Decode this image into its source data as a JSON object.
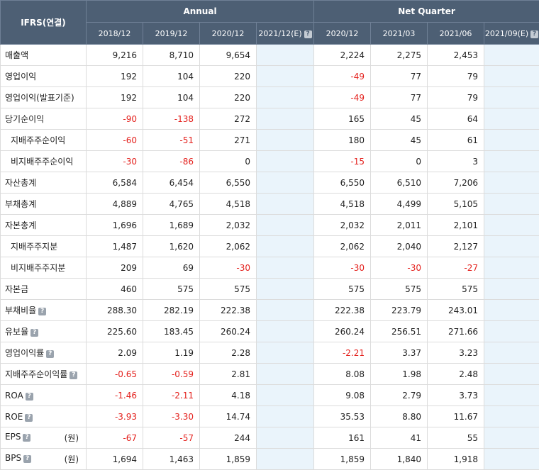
{
  "table": {
    "corner_label": "IFRS(연결)",
    "groups": [
      {
        "label": "Annual",
        "span": 4
      },
      {
        "label": "Net Quarter",
        "span": 4
      }
    ],
    "periods": [
      {
        "label": "2018/12",
        "estimate": false
      },
      {
        "label": "2019/12",
        "estimate": false
      },
      {
        "label": "2020/12",
        "estimate": false
      },
      {
        "label": "2021/12(E)",
        "estimate": true
      },
      {
        "label": "2020/12",
        "estimate": false
      },
      {
        "label": "2021/03",
        "estimate": false
      },
      {
        "label": "2021/06",
        "estimate": false
      },
      {
        "label": "2021/09(E)",
        "estimate": true
      }
    ],
    "rows": [
      {
        "label": "매출액",
        "sub": false,
        "help": false,
        "unit": "",
        "values": [
          "9,216",
          "8,710",
          "9,654",
          "",
          "2,224",
          "2,275",
          "2,453",
          ""
        ]
      },
      {
        "label": "영업이익",
        "sub": false,
        "help": false,
        "unit": "",
        "values": [
          "192",
          "104",
          "220",
          "",
          "-49",
          "77",
          "79",
          ""
        ]
      },
      {
        "label": "영업이익(발표기준)",
        "sub": false,
        "help": false,
        "unit": "",
        "values": [
          "192",
          "104",
          "220",
          "",
          "-49",
          "77",
          "79",
          ""
        ]
      },
      {
        "label": "당기순이익",
        "sub": false,
        "help": false,
        "unit": "",
        "values": [
          "-90",
          "-138",
          "272",
          "",
          "165",
          "45",
          "64",
          ""
        ]
      },
      {
        "label": "지배주주순이익",
        "sub": true,
        "help": false,
        "unit": "",
        "values": [
          "-60",
          "-51",
          "271",
          "",
          "180",
          "45",
          "61",
          ""
        ]
      },
      {
        "label": "비지배주주순이익",
        "sub": true,
        "help": false,
        "unit": "",
        "values": [
          "-30",
          "-86",
          "0",
          "",
          "-15",
          "0",
          "3",
          ""
        ]
      },
      {
        "label": "자산총계",
        "sub": false,
        "help": false,
        "unit": "",
        "values": [
          "6,584",
          "6,454",
          "6,550",
          "",
          "6,550",
          "6,510",
          "7,206",
          ""
        ]
      },
      {
        "label": "부채총계",
        "sub": false,
        "help": false,
        "unit": "",
        "values": [
          "4,889",
          "4,765",
          "4,518",
          "",
          "4,518",
          "4,499",
          "5,105",
          ""
        ]
      },
      {
        "label": "자본총계",
        "sub": false,
        "help": false,
        "unit": "",
        "values": [
          "1,696",
          "1,689",
          "2,032",
          "",
          "2,032",
          "2,011",
          "2,101",
          ""
        ]
      },
      {
        "label": "지배주주지분",
        "sub": true,
        "help": false,
        "unit": "",
        "values": [
          "1,487",
          "1,620",
          "2,062",
          "",
          "2,062",
          "2,040",
          "2,127",
          ""
        ]
      },
      {
        "label": "비지배주주지분",
        "sub": true,
        "help": false,
        "unit": "",
        "values": [
          "209",
          "69",
          "-30",
          "",
          "-30",
          "-30",
          "-27",
          ""
        ]
      },
      {
        "label": "자본금",
        "sub": false,
        "help": false,
        "unit": "",
        "values": [
          "460",
          "575",
          "575",
          "",
          "575",
          "575",
          "575",
          ""
        ]
      },
      {
        "label": "부채비율",
        "sub": false,
        "help": true,
        "unit": "",
        "values": [
          "288.30",
          "282.19",
          "222.38",
          "",
          "222.38",
          "223.79",
          "243.01",
          ""
        ]
      },
      {
        "label": "유보율",
        "sub": false,
        "help": true,
        "unit": "",
        "values": [
          "225.60",
          "183.45",
          "260.24",
          "",
          "260.24",
          "256.51",
          "271.66",
          ""
        ]
      },
      {
        "label": "영업이익률",
        "sub": false,
        "help": true,
        "unit": "",
        "values": [
          "2.09",
          "1.19",
          "2.28",
          "",
          "-2.21",
          "3.37",
          "3.23",
          ""
        ]
      },
      {
        "label": "지배주주순이익률",
        "sub": false,
        "help": true,
        "unit": "",
        "values": [
          "-0.65",
          "-0.59",
          "2.81",
          "",
          "8.08",
          "1.98",
          "2.48",
          ""
        ]
      },
      {
        "label": "ROA",
        "sub": false,
        "help": true,
        "unit": "",
        "values": [
          "-1.46",
          "-2.11",
          "4.18",
          "",
          "9.08",
          "2.79",
          "3.73",
          ""
        ]
      },
      {
        "label": "ROE",
        "sub": false,
        "help": true,
        "unit": "",
        "values": [
          "-3.93",
          "-3.30",
          "14.74",
          "",
          "35.53",
          "8.80",
          "11.67",
          ""
        ]
      },
      {
        "label": "EPS",
        "sub": false,
        "help": true,
        "unit": "(원)",
        "values": [
          "-67",
          "-57",
          "244",
          "",
          "161",
          "41",
          "55",
          ""
        ]
      },
      {
        "label": "BPS",
        "sub": false,
        "help": true,
        "unit": "(원)",
        "values": [
          "1,694",
          "1,463",
          "1,859",
          "",
          "1,859",
          "1,840",
          "1,918",
          ""
        ]
      }
    ]
  },
  "colors": {
    "header_bg": "#4d5f74",
    "estimate_bg": "#eaf4fb",
    "negative_text": "#e4211d"
  },
  "icons": {
    "help": "question-mark-icon",
    "help_glyph": "?"
  }
}
